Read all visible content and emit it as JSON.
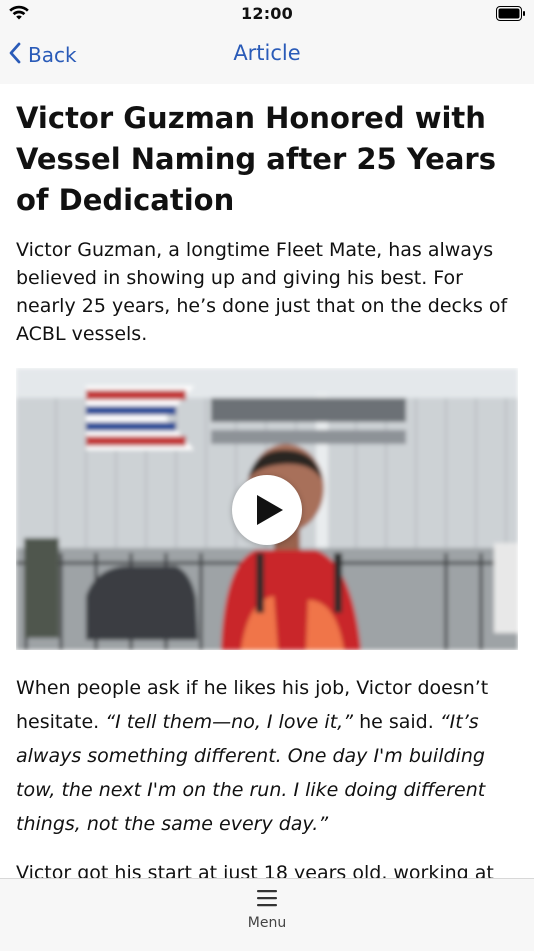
{
  "status_bar": {
    "time": "12:00",
    "icons": [
      "wifi-icon",
      "battery-icon"
    ]
  },
  "nav": {
    "back_label": "Back",
    "title": "Article"
  },
  "article": {
    "headline": "Victor Guzman Honored with Vessel Naming after 25 Years of Dedication",
    "lead": "Victor Guzman, a longtime Fleet Mate, has always believed in showing up and giving his best. For nearly 25 years, he’s done just that on the decks of ACBL vessels.",
    "video": {
      "play_icon": "play-icon"
    },
    "para1": {
      "text": "When people ask if he likes his job, Victor doesn’t hesitate. ",
      "quote1": "“I tell them—no, I love it,”",
      "said": " he said. ",
      "quote2": "“It’s always something different. One day I'm building tow, the next I'm on the run. I like doing different things, not the same every day.”"
    },
    "para2": "Victor got his start at just 18 years old, working at"
  },
  "tab_bar": {
    "menu_label": "Menu",
    "menu_icon": "hamburger-icon"
  },
  "colors": {
    "accent": "#2a5bb8",
    "bar_background": "#f7f7f7"
  }
}
